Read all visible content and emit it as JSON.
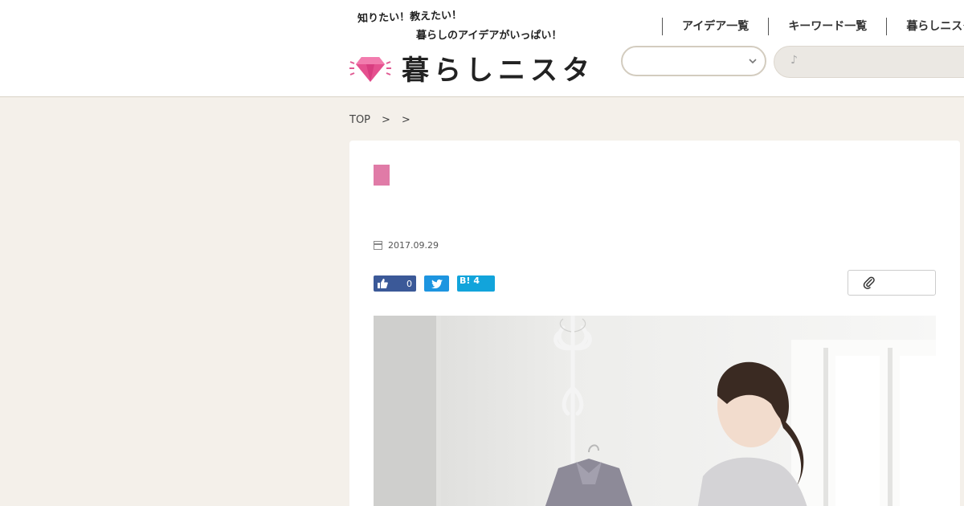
{
  "header": {
    "tagline_line1": "知りたい！教えたい！",
    "tagline_line2": "暮らしのアイデアがいっぱい！",
    "logo_text": "暮らしニスタ",
    "nav": [
      {
        "label": "アイデア一覧"
      },
      {
        "label": "キーワード一覧"
      },
      {
        "label": "暮らしニスタ"
      }
    ],
    "select_value": "",
    "search_placeholder": "♪"
  },
  "breadcrumb": {
    "top": "TOP",
    "sep1": ">",
    "sep2": ">"
  },
  "article": {
    "date": "2017.09.29",
    "share": {
      "like_count": "0",
      "hatena_label": "B!",
      "hatena_count": "4"
    }
  },
  "colors": {
    "accent_pink": "#e07ba7",
    "facebook": "#3b5998",
    "twitter": "#1d95e0",
    "hatena": "#12a4db",
    "page_bg": "#f4f0ea"
  }
}
